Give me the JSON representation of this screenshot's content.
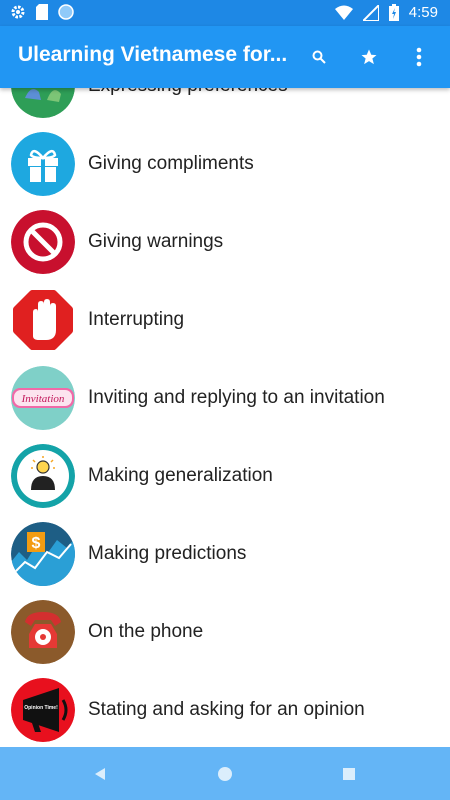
{
  "status": {
    "time": "4:59"
  },
  "appbar": {
    "title": "Ulearning Vietnamese for...",
    "search_icon": "search-icon",
    "star_icon": "star-icon",
    "more_icon": "more-vert-icon",
    "color": "#2196f3"
  },
  "topics": [
    {
      "label": "Expressing preferences",
      "icon": "thumbs-icon"
    },
    {
      "label": "Giving compliments",
      "icon": "gift-icon"
    },
    {
      "label": "Giving warnings",
      "icon": "no-entry-icon"
    },
    {
      "label": "Interrupting",
      "icon": "stop-hand-icon"
    },
    {
      "label": "Inviting and replying to an invitation",
      "icon": "invitation-icon",
      "icon_text": "Invitation"
    },
    {
      "label": "Making generalization",
      "icon": "idea-person-icon"
    },
    {
      "label": "Making predictions",
      "icon": "dollar-chart-icon"
    },
    {
      "label": "On the phone",
      "icon": "phone-icon"
    },
    {
      "label": "Stating and asking for an opinion",
      "icon": "megaphone-icon",
      "icon_text": "Opinion Time!"
    }
  ],
  "navbar": {
    "back_icon": "back-icon",
    "home_icon": "home-icon",
    "recents_icon": "recents-icon"
  }
}
